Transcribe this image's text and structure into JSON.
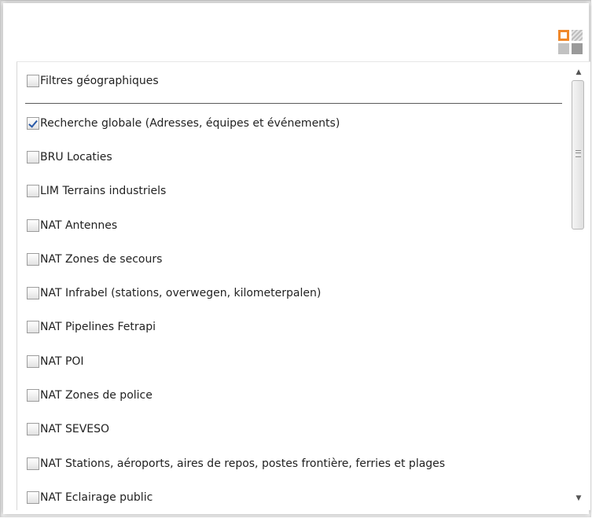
{
  "toolbar": {
    "layout_toggle_icon": "layout-grid-icon",
    "accent_color": "#f0882a"
  },
  "filters": {
    "header_item": {
      "label": "Filtres géographiques",
      "checked": false
    },
    "items": [
      {
        "label": "Recherche globale (Adresses, équipes et événements)",
        "checked": true
      },
      {
        "label": "BRU Locaties",
        "checked": false
      },
      {
        "label": "LIM Terrains industriels",
        "checked": false
      },
      {
        "label": "NAT Antennes",
        "checked": false
      },
      {
        "label": "NAT Zones de secours",
        "checked": false
      },
      {
        "label": "NAT Infrabel (stations, overwegen, kilometerpalen)",
        "checked": false
      },
      {
        "label": "NAT Pipelines Fetrapi",
        "checked": false
      },
      {
        "label": "NAT POI",
        "checked": false
      },
      {
        "label": "NAT Zones de police",
        "checked": false
      },
      {
        "label": "NAT SEVESO",
        "checked": false
      },
      {
        "label": "NAT Stations, aéroports, aires de repos, postes frontière, ferries et plages",
        "checked": false
      },
      {
        "label": "NAT Eclairage public",
        "checked": false
      }
    ]
  },
  "scrollbar": {
    "up_glyph": "▲",
    "down_glyph": "▼"
  }
}
